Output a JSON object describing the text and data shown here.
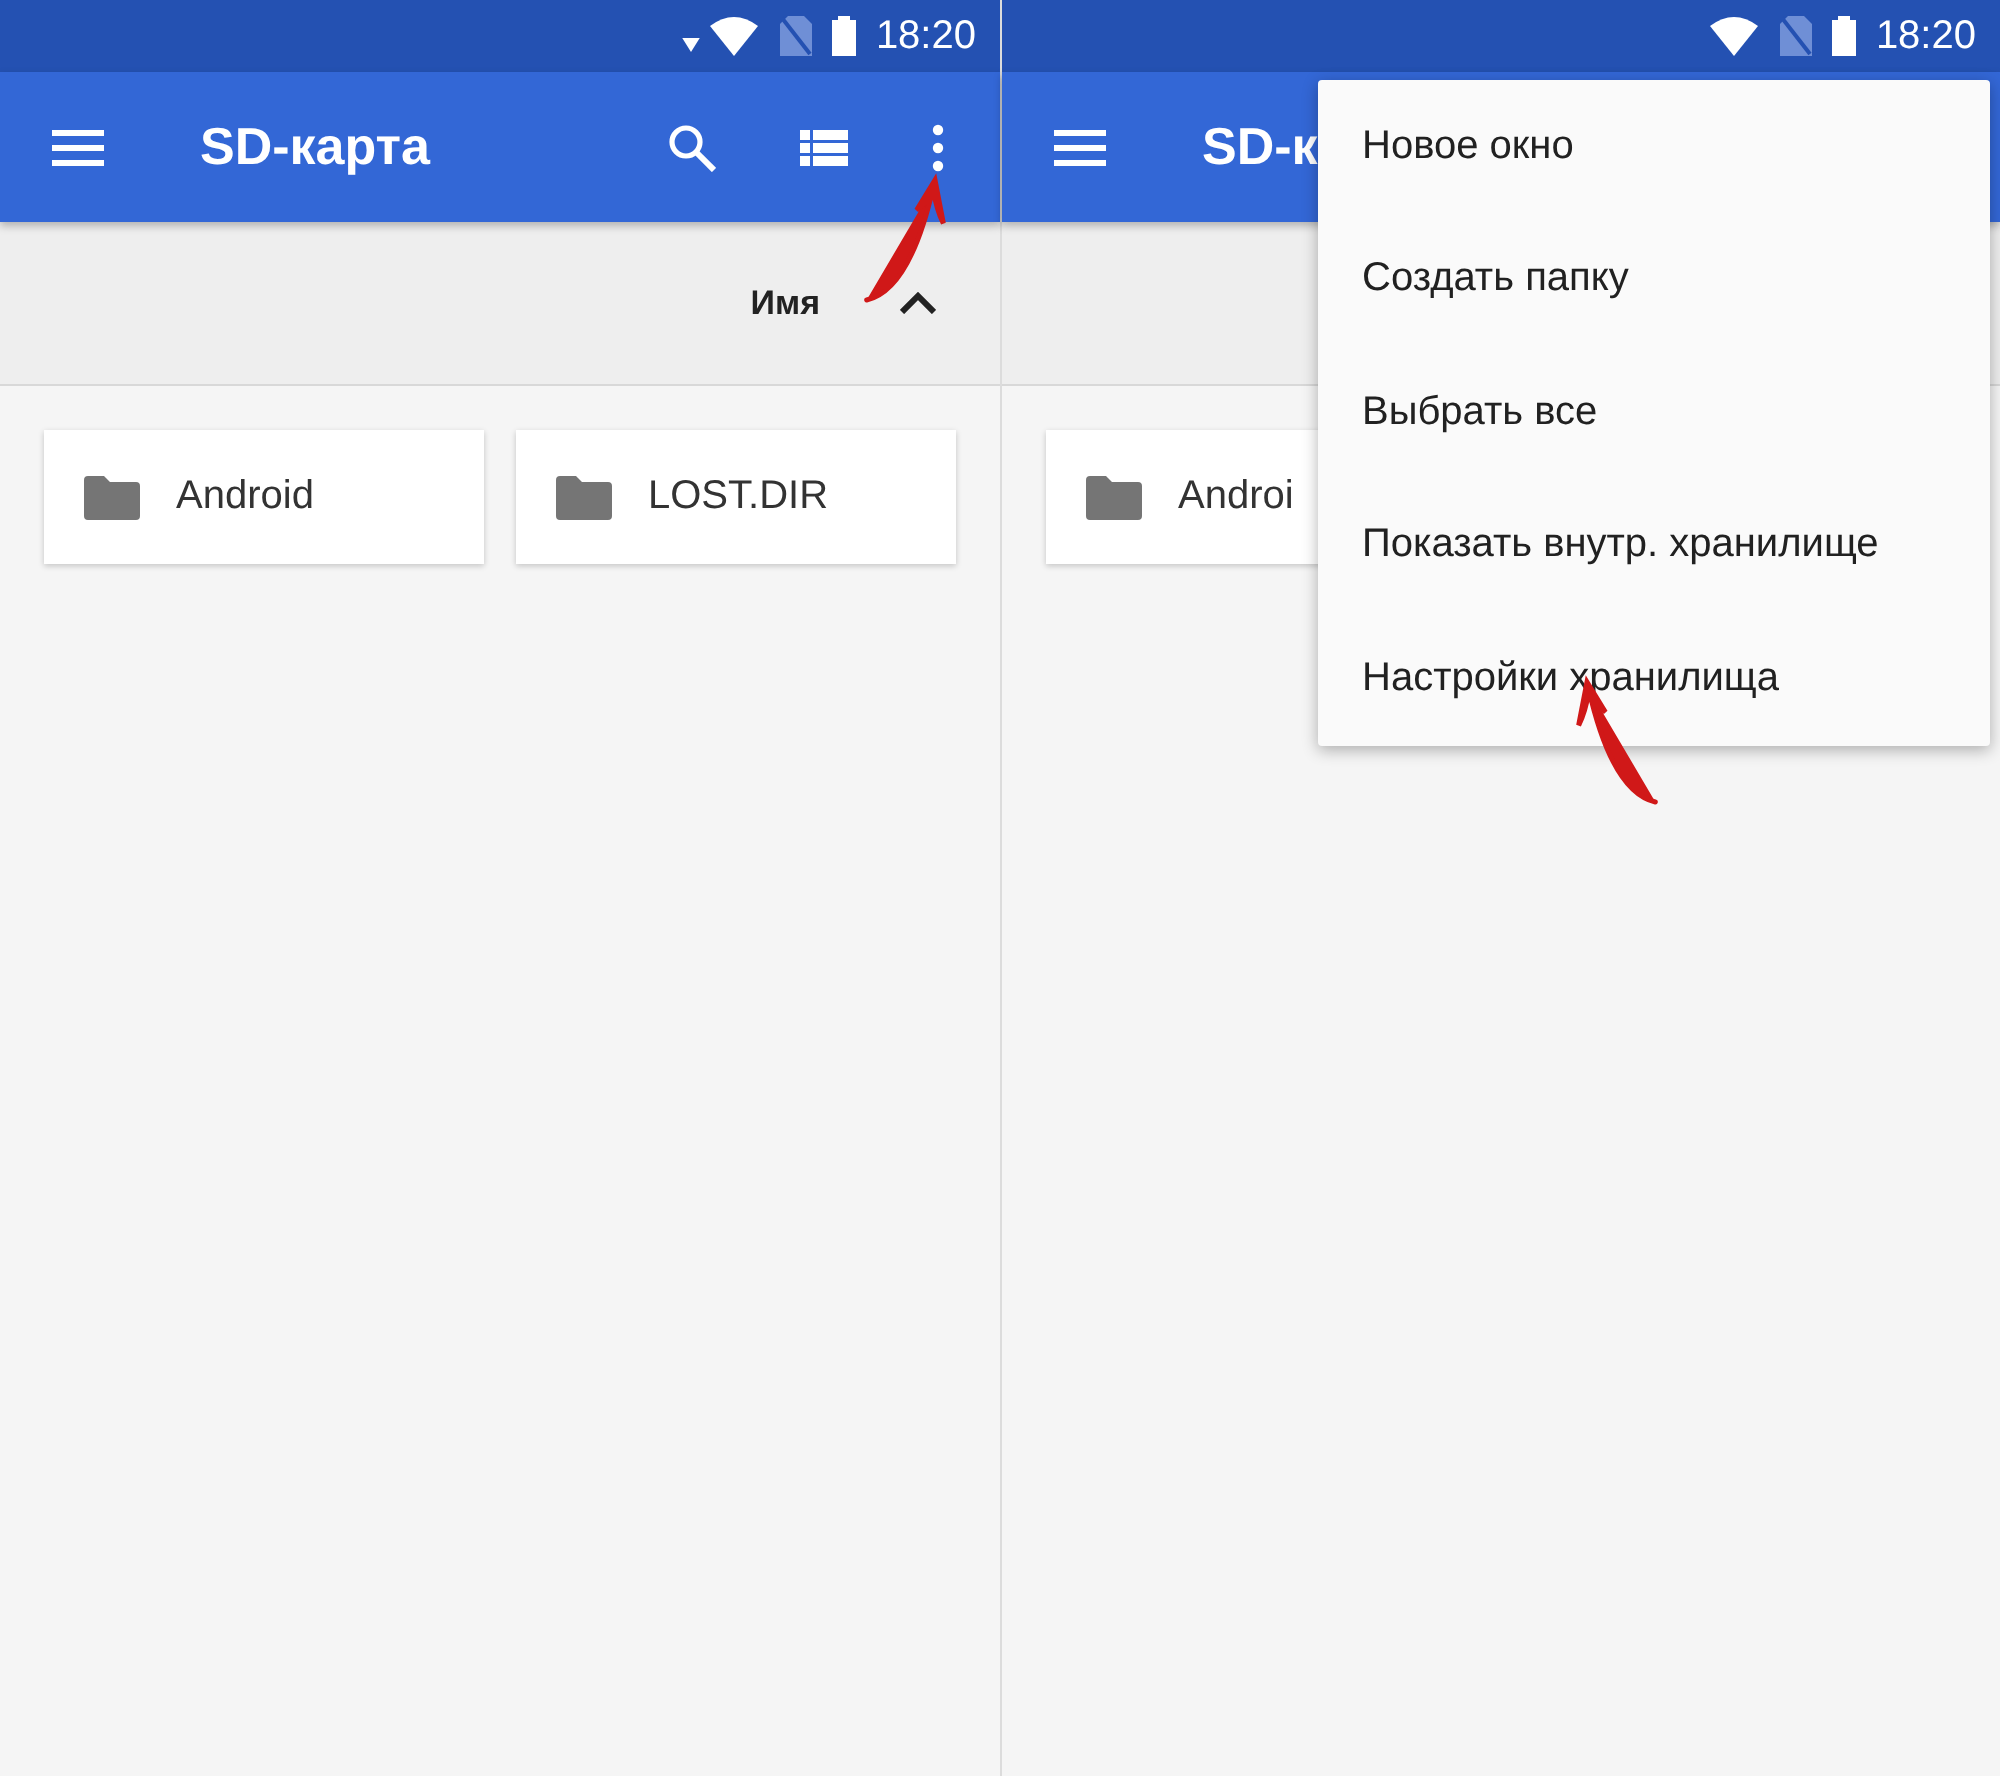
{
  "screens": [
    {
      "status_bar": {
        "time": "18:20",
        "data_activity": true
      },
      "toolbar": {
        "title": "SD-карта",
        "show_actions": true
      },
      "sort": {
        "label": "Имя"
      },
      "folders": [
        {
          "name": "Android"
        },
        {
          "name": "LOST.DIR"
        }
      ],
      "pointer_arrow": true
    },
    {
      "status_bar": {
        "time": "18:20",
        "data_activity": false
      },
      "toolbar": {
        "title": "SD-к"
      },
      "folders": [
        {
          "name": "Androi"
        }
      ],
      "pointer_arrow": true,
      "menu": {
        "items": [
          {
            "label": "Новое окно"
          },
          {
            "label": "Создать папку"
          },
          {
            "label": "Выбрать все"
          },
          {
            "label": "Показать внутр. хранилище"
          },
          {
            "label": "Настройки хранилища"
          }
        ]
      }
    }
  ]
}
